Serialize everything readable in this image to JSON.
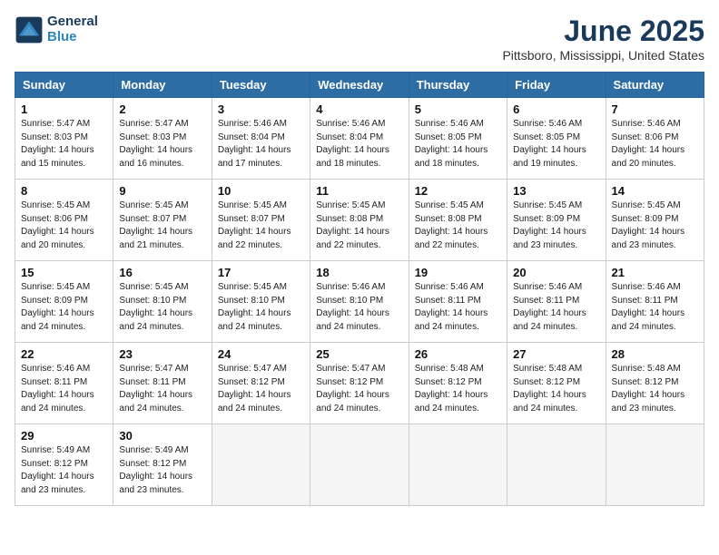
{
  "logo": {
    "line1": "General",
    "line2": "Blue"
  },
  "title": "June 2025",
  "subtitle": "Pittsboro, Mississippi, United States",
  "headers": [
    "Sunday",
    "Monday",
    "Tuesday",
    "Wednesday",
    "Thursday",
    "Friday",
    "Saturday"
  ],
  "weeks": [
    [
      {
        "day": "1",
        "info": "Sunrise: 5:47 AM\nSunset: 8:03 PM\nDaylight: 14 hours\nand 15 minutes."
      },
      {
        "day": "2",
        "info": "Sunrise: 5:47 AM\nSunset: 8:03 PM\nDaylight: 14 hours\nand 16 minutes."
      },
      {
        "day": "3",
        "info": "Sunrise: 5:46 AM\nSunset: 8:04 PM\nDaylight: 14 hours\nand 17 minutes."
      },
      {
        "day": "4",
        "info": "Sunrise: 5:46 AM\nSunset: 8:04 PM\nDaylight: 14 hours\nand 18 minutes."
      },
      {
        "day": "5",
        "info": "Sunrise: 5:46 AM\nSunset: 8:05 PM\nDaylight: 14 hours\nand 18 minutes."
      },
      {
        "day": "6",
        "info": "Sunrise: 5:46 AM\nSunset: 8:05 PM\nDaylight: 14 hours\nand 19 minutes."
      },
      {
        "day": "7",
        "info": "Sunrise: 5:46 AM\nSunset: 8:06 PM\nDaylight: 14 hours\nand 20 minutes."
      }
    ],
    [
      {
        "day": "8",
        "info": "Sunrise: 5:45 AM\nSunset: 8:06 PM\nDaylight: 14 hours\nand 20 minutes."
      },
      {
        "day": "9",
        "info": "Sunrise: 5:45 AM\nSunset: 8:07 PM\nDaylight: 14 hours\nand 21 minutes."
      },
      {
        "day": "10",
        "info": "Sunrise: 5:45 AM\nSunset: 8:07 PM\nDaylight: 14 hours\nand 22 minutes."
      },
      {
        "day": "11",
        "info": "Sunrise: 5:45 AM\nSunset: 8:08 PM\nDaylight: 14 hours\nand 22 minutes."
      },
      {
        "day": "12",
        "info": "Sunrise: 5:45 AM\nSunset: 8:08 PM\nDaylight: 14 hours\nand 22 minutes."
      },
      {
        "day": "13",
        "info": "Sunrise: 5:45 AM\nSunset: 8:09 PM\nDaylight: 14 hours\nand 23 minutes."
      },
      {
        "day": "14",
        "info": "Sunrise: 5:45 AM\nSunset: 8:09 PM\nDaylight: 14 hours\nand 23 minutes."
      }
    ],
    [
      {
        "day": "15",
        "info": "Sunrise: 5:45 AM\nSunset: 8:09 PM\nDaylight: 14 hours\nand 24 minutes."
      },
      {
        "day": "16",
        "info": "Sunrise: 5:45 AM\nSunset: 8:10 PM\nDaylight: 14 hours\nand 24 minutes."
      },
      {
        "day": "17",
        "info": "Sunrise: 5:45 AM\nSunset: 8:10 PM\nDaylight: 14 hours\nand 24 minutes."
      },
      {
        "day": "18",
        "info": "Sunrise: 5:46 AM\nSunset: 8:10 PM\nDaylight: 14 hours\nand 24 minutes."
      },
      {
        "day": "19",
        "info": "Sunrise: 5:46 AM\nSunset: 8:11 PM\nDaylight: 14 hours\nand 24 minutes."
      },
      {
        "day": "20",
        "info": "Sunrise: 5:46 AM\nSunset: 8:11 PM\nDaylight: 14 hours\nand 24 minutes."
      },
      {
        "day": "21",
        "info": "Sunrise: 5:46 AM\nSunset: 8:11 PM\nDaylight: 14 hours\nand 24 minutes."
      }
    ],
    [
      {
        "day": "22",
        "info": "Sunrise: 5:46 AM\nSunset: 8:11 PM\nDaylight: 14 hours\nand 24 minutes."
      },
      {
        "day": "23",
        "info": "Sunrise: 5:47 AM\nSunset: 8:11 PM\nDaylight: 14 hours\nand 24 minutes."
      },
      {
        "day": "24",
        "info": "Sunrise: 5:47 AM\nSunset: 8:12 PM\nDaylight: 14 hours\nand 24 minutes."
      },
      {
        "day": "25",
        "info": "Sunrise: 5:47 AM\nSunset: 8:12 PM\nDaylight: 14 hours\nand 24 minutes."
      },
      {
        "day": "26",
        "info": "Sunrise: 5:48 AM\nSunset: 8:12 PM\nDaylight: 14 hours\nand 24 minutes."
      },
      {
        "day": "27",
        "info": "Sunrise: 5:48 AM\nSunset: 8:12 PM\nDaylight: 14 hours\nand 24 minutes."
      },
      {
        "day": "28",
        "info": "Sunrise: 5:48 AM\nSunset: 8:12 PM\nDaylight: 14 hours\nand 23 minutes."
      }
    ],
    [
      {
        "day": "29",
        "info": "Sunrise: 5:49 AM\nSunset: 8:12 PM\nDaylight: 14 hours\nand 23 minutes."
      },
      {
        "day": "30",
        "info": "Sunrise: 5:49 AM\nSunset: 8:12 PM\nDaylight: 14 hours\nand 23 minutes."
      },
      {
        "day": "",
        "info": ""
      },
      {
        "day": "",
        "info": ""
      },
      {
        "day": "",
        "info": ""
      },
      {
        "day": "",
        "info": ""
      },
      {
        "day": "",
        "info": ""
      }
    ]
  ]
}
